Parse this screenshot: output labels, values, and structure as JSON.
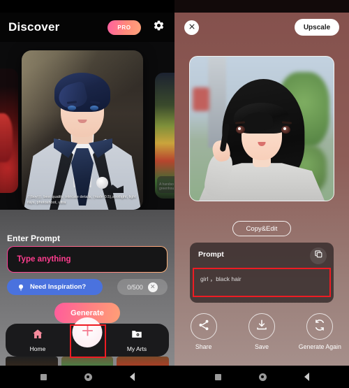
{
  "left": {
    "header": {
      "title": "Discover",
      "pro_label": "PRO",
      "gear_icon": "gear-icon"
    },
    "carousel": {
      "main_caption": "(((boy))), best quality, intricate details, (nude:0.5),spotlight, light rays, photoshoot, ultra",
      "side_caption": "A handso greenhou"
    },
    "prompt_section": {
      "label": "Enter Prompt",
      "placeholder": "Type anything",
      "value": "",
      "inspiration_label": "Need Inspiration?",
      "inspiration_icon": "lightbulb-icon",
      "counter": "0/500",
      "clear_icon": "close-circle-icon",
      "generate_label": "Generate"
    },
    "tabbar": {
      "items": [
        {
          "label": "Home",
          "icon": "home-icon"
        },
        {
          "label": "My Arts",
          "icon": "folder-icon"
        }
      ],
      "fab_icon": "plus-icon"
    }
  },
  "right": {
    "header": {
      "close_icon": "close-icon",
      "upscale_label": "Upscale"
    },
    "copy_edit_label": "Copy&Edit",
    "prompt_card": {
      "label": "Prompt",
      "copy_icon": "copy-icon",
      "value": "girl ，black hair"
    },
    "actions": [
      {
        "label": "Share",
        "icon": "share-icon"
      },
      {
        "label": "Save",
        "icon": "download-icon"
      },
      {
        "label": "Generate Again",
        "icon": "refresh-icon"
      }
    ]
  },
  "system_nav": {
    "recent_icon": "square-icon",
    "home_icon": "circle-icon",
    "back_icon": "chevron-left-icon"
  },
  "colors": {
    "accent_pink": "#ff3d8f",
    "accent_gradient_start": "#ff5b9c",
    "accent_gradient_end": "#ff9f76",
    "inspire_blue": "#4a72de",
    "annotation_red": "#ee1c23",
    "right_panel_bg": "#8d5c56"
  }
}
